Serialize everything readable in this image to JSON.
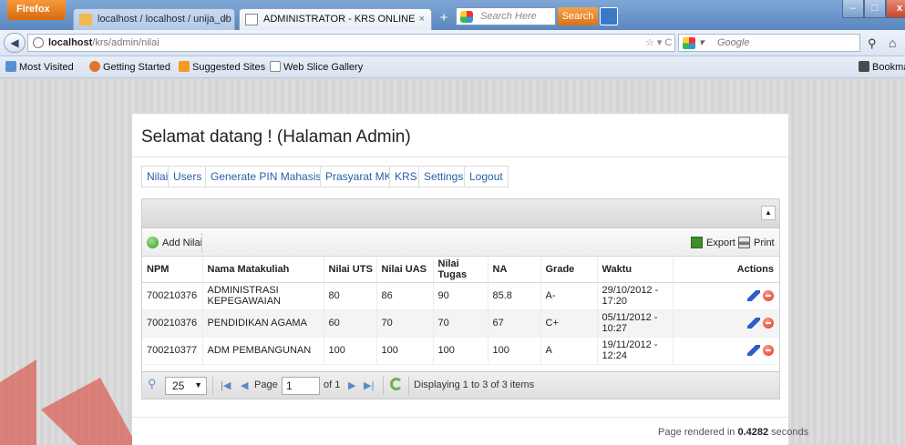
{
  "browser": {
    "menu_button": "Firefox",
    "tabs": [
      {
        "label": "localhost / localhost / unija_db | php..."
      },
      {
        "label": "ADMINISTRATOR - KRS ONLINE"
      }
    ],
    "search_placeholder": "Search Here",
    "search_button": "Search",
    "url_host": "localhost",
    "url_path": "/krs/admin/nilai",
    "google_placeholder": "Google",
    "bookmarks": [
      "Most Visited",
      "Getting Started",
      "Suggested Sites",
      "Web Slice Gallery"
    ],
    "bookmarks_right": "Bookmar"
  },
  "page": {
    "welcome": "Selamat datang ! (Halaman Admin)",
    "menu": [
      "Nilai",
      "Users",
      "Generate PIN Mahasiswa",
      "Prasyarat MK",
      "KRS",
      "Settings",
      "Logout"
    ],
    "toolbar": {
      "add": "Add Nilai",
      "export": "Export",
      "print": "Print"
    },
    "columns": [
      "NPM",
      "Nama Matakuliah",
      "Nilai UTS",
      "Nilai UAS",
      "Nilai Tugas",
      "NA",
      "Grade",
      "Waktu",
      "Actions"
    ],
    "rows": [
      {
        "npm": "700210376",
        "matakuliah": "ADMINISTRASI KEPEGAWAIAN",
        "uts": "80",
        "uas": "86",
        "tugas": "90",
        "na": "85.8",
        "grade": "A-",
        "waktu": "29/10/2012 - 17:20"
      },
      {
        "npm": "700210376",
        "matakuliah": "PENDIDIKAN AGAMA",
        "uts": "60",
        "uas": "70",
        "tugas": "70",
        "na": "67",
        "grade": "C+",
        "waktu": "05/11/2012 - 10:27"
      },
      {
        "npm": "700210377",
        "matakuliah": "ADM PEMBANGUNAN",
        "uts": "100",
        "uas": "100",
        "tugas": "100",
        "na": "100",
        "grade": "A",
        "waktu": "19/11/2012 - 12:24"
      }
    ],
    "pager": {
      "per_page": "25",
      "page_label": "Page",
      "page_value": "1",
      "of_label": "of 1",
      "display": "Displaying 1 to 3 of 3 items"
    },
    "footer": {
      "prefix": "Page rendered in ",
      "time": "0.4282",
      "suffix": " seconds"
    }
  },
  "colors": {
    "link": "#2a5ea8",
    "watermark": "#d93a2a"
  }
}
